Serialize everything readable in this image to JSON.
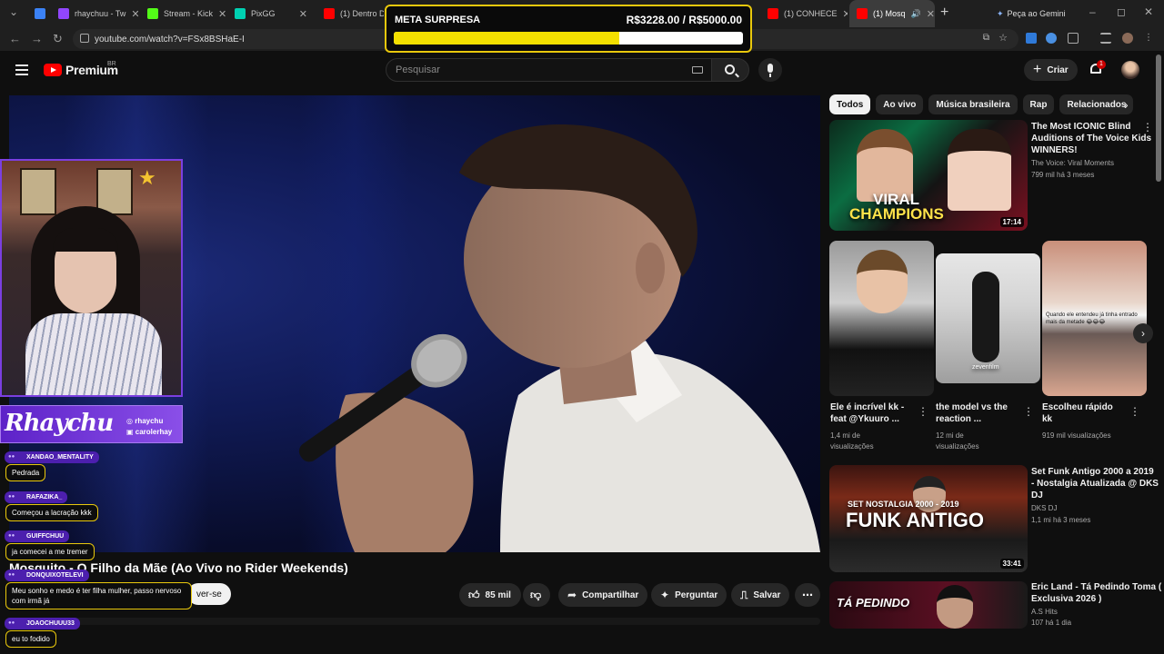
{
  "browser": {
    "tabs": [
      {
        "title": "rhaychuu - Tw",
        "color": "#9146ff"
      },
      {
        "title": "Stream - Kick",
        "color": "#53fc18"
      },
      {
        "title": "PixGG",
        "color": "#00d1b2"
      },
      {
        "title": "(1) Dentro Da",
        "color": "#ff0000"
      },
      {
        "title": "(1) CONHECE",
        "color": "#ff0000"
      },
      {
        "title": "(1) Mosq",
        "color": "#ff0000"
      }
    ],
    "gemini_label": "Peça ao Gemini",
    "url": "youtube.com/watch?v=FSx8BSHaE-I"
  },
  "goal": {
    "title": "META SURPRESA",
    "amount": "R$3228.00 / R$5000.00",
    "progress": 0.6456
  },
  "header": {
    "logo_text": "Premium",
    "country": "BR",
    "search_placeholder": "Pesquisar",
    "create_label": "Criar",
    "notification_count": "1"
  },
  "video": {
    "title": "Mosquito - O Filho da Mãe (Ao Vivo no Rider Weekends)",
    "subscribe_label": "ver-se",
    "likes": "85 mil",
    "share_label": "Compartilhar",
    "ask_label": "Perguntar",
    "save_label": "Salvar"
  },
  "chips": [
    "Todos",
    "Ao vivo",
    "Música brasileira",
    "Rap",
    "Relacionados"
  ],
  "recommendations": [
    {
      "title_1": "The Most ICONIC Blind",
      "title_2": "Auditions of The Voice Kids",
      "title_3": "WINNERS!",
      "channel": "The Voice: Viral Moments",
      "meta": "799 mil  há 3 meses",
      "duration": "17:14",
      "thumb_text_1": "VIRAL",
      "thumb_text_2": "CHAMPIONS"
    },
    {
      "title_1": "Set Funk Antigo 2000 a 2019",
      "title_2": "- Nostalgia Atualizada @ DKS",
      "title_3": "DJ",
      "channel": "DKS DJ",
      "meta": "1,1 mi  há 3 meses",
      "duration": "33:41",
      "thumb_text_1": "SET NOSTALGIA  2000 - 2019",
      "thumb_text_2": "FUNK ANTIGO"
    },
    {
      "title_1": "Eric Land - Tá Pedindo Toma (",
      "title_2": "Exclusiva 2026 )",
      "channel": "A.S Hits",
      "meta": "107  há 1 dia",
      "thumb_text_1": "TÁ PEDINDO"
    }
  ],
  "shorts": [
    {
      "title_1": "Ele é incrível kk -",
      "title_2": "feat @Ykuuro ...",
      "meta_1": "1,4 mi de",
      "meta_2": "visualizações"
    },
    {
      "title_1": "the model vs the",
      "title_2": "reaction ...",
      "meta_1": "12 mi de",
      "meta_2": "visualizações",
      "caption": "zevenfilm"
    },
    {
      "title_1": "Escolheu rápido",
      "title_2": "kk",
      "meta_1": "919 mil visualizações",
      "caption": "Quando ele entendeu já tinha entrado mais da metade 😂😂😂"
    }
  ],
  "overlay": {
    "streamer_name": "Rhaychu",
    "handle_1": "rhaychu",
    "handle_2": "carolerhay",
    "chat": [
      {
        "user": "XANDAO_MENTALITY",
        "text": "Pedrada"
      },
      {
        "user": "RAFAZIKA_",
        "text": "Começou a lacração kkk"
      },
      {
        "user": "GUIFFCHUU",
        "text": "ja comecei a me tremer"
      },
      {
        "user": "DONQUIXOTELEVI",
        "text": "Meu sonho e medo é ter filha mulher, passo nervoso com irmã já"
      },
      {
        "user": "JOAOCHUUU33",
        "text": "eu to fodido"
      }
    ]
  }
}
